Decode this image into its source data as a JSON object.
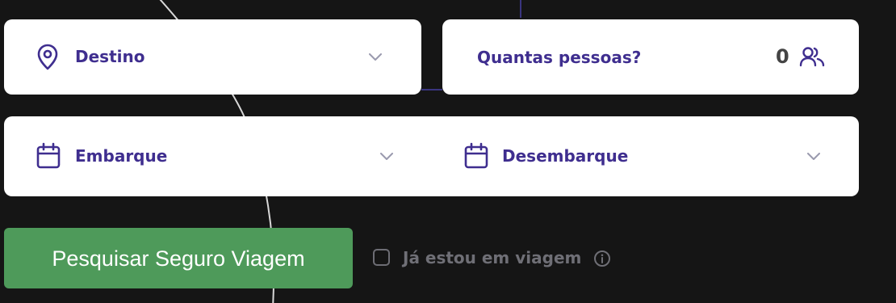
{
  "form": {
    "destination": {
      "label": "Destino",
      "icon": "map-pin-icon"
    },
    "travelers": {
      "label": "Quantas pessoas?",
      "count": "0",
      "icon": "users-icon"
    },
    "departure": {
      "label": "Embarque",
      "icon": "calendar-icon"
    },
    "return": {
      "label": "Desembarque",
      "icon": "calendar-icon"
    },
    "search_button": "Pesquisar Seguro Viagem",
    "already_traveling": {
      "label": "Já estou em viagem",
      "checked": false,
      "icon": "info-icon"
    }
  },
  "colors": {
    "background": "#151515",
    "card": "#ffffff",
    "accent": "#3f2e8f",
    "button": "#4e9a5a",
    "muted": "#6f6f76"
  }
}
